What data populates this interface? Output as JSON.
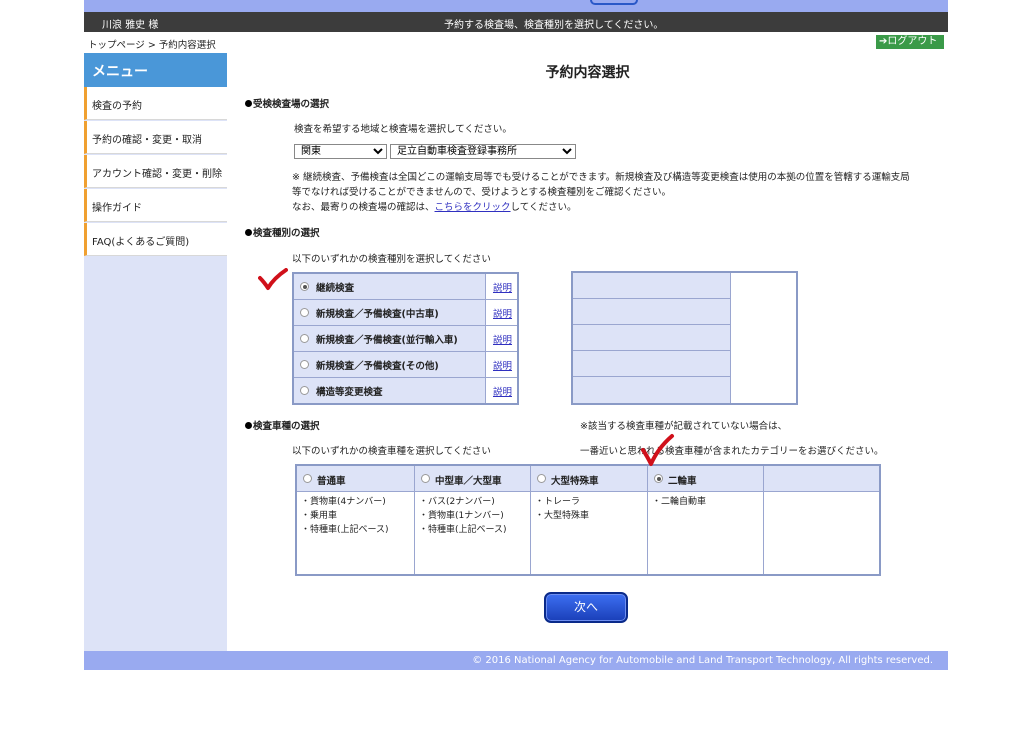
{
  "header": {
    "user_name": "川浪 雅史 様",
    "instruction": "予約する検査場、検査種別を選択してください。"
  },
  "breadcrumb": "トップページ > 予約内容選択",
  "logout_label": "ログアウト",
  "sidebar": {
    "title": "メニュー",
    "items": [
      {
        "label": "検査の予約"
      },
      {
        "label": "予約の確認・変更・取消"
      },
      {
        "label": "アカウント確認・変更・削除"
      },
      {
        "label": "操作ガイド"
      },
      {
        "label": "FAQ(よくあるご質問)"
      }
    ]
  },
  "main": {
    "page_title": "予約内容選択",
    "site_section": {
      "heading": "受検検査場の選択",
      "instruction": "検査を希望する地域と検査場を選択してください。",
      "region_value": "関東",
      "site_value": "足立自動車検査登録事務所",
      "note_line1": "※ 継続検査、予備検査は全国どこの運輸支局等でも受けることができます。新規検査及び構造等変更検査は使用の本拠の位置を管轄する運輸支局",
      "note_line2": "等でなければ受けることができませんので、受けようとする検査種別をご確認ください。",
      "note_line3_prefix": "なお、最寄りの検査場の確認は、",
      "note_link": "こちらをクリック",
      "note_line3_suffix": "してください。"
    },
    "type_section": {
      "heading": "検査種別の選択",
      "instruction": "以下のいずれかの検査種別を選択してください",
      "explain_label": "説明",
      "types": [
        {
          "label": "継続検査"
        },
        {
          "label": "新規検査／予備検査(中古車)"
        },
        {
          "label": "新規検査／予備検査(並行輸入車)"
        },
        {
          "label": "新規検査／予備検査(その他)"
        },
        {
          "label": "構造等変更検査"
        }
      ]
    },
    "vehicle_section": {
      "heading": "検査車種の選択",
      "instruction": "以下のいずれかの検査車種を選択してください",
      "note_line1": "※該当する検査車種が記載されていない場合は、",
      "note_line2": "一番近いと思われる検査車種が含まれたカテゴリーをお選びください。",
      "categories": [
        {
          "label": "普通車",
          "examples": [
            "・貨物車(4ナンバー)",
            "・乗用車",
            "・特種車(上記ベース)"
          ]
        },
        {
          "label": "中型車／大型車",
          "examples": [
            "・バス(2ナンバー)",
            "・貨物車(1ナンバー)",
            "・特種車(上記ベース)"
          ]
        },
        {
          "label": "大型特殊車",
          "examples": [
            "・トレーラ",
            "・大型特殊車"
          ]
        },
        {
          "label": "二輪車",
          "examples": [
            "・二輪自動車"
          ]
        }
      ]
    },
    "next_label": "次へ"
  },
  "footer": "© 2016 National Agency for Automobile and Land Transport Technology, All rights reserved.",
  "colors": {
    "accent_blue": "#99aaf0",
    "menu_header": "#4a97d8",
    "cell_fill": "#dde3f7",
    "logout_green": "#3a9a48",
    "checkmark_red": "#d0101a"
  }
}
